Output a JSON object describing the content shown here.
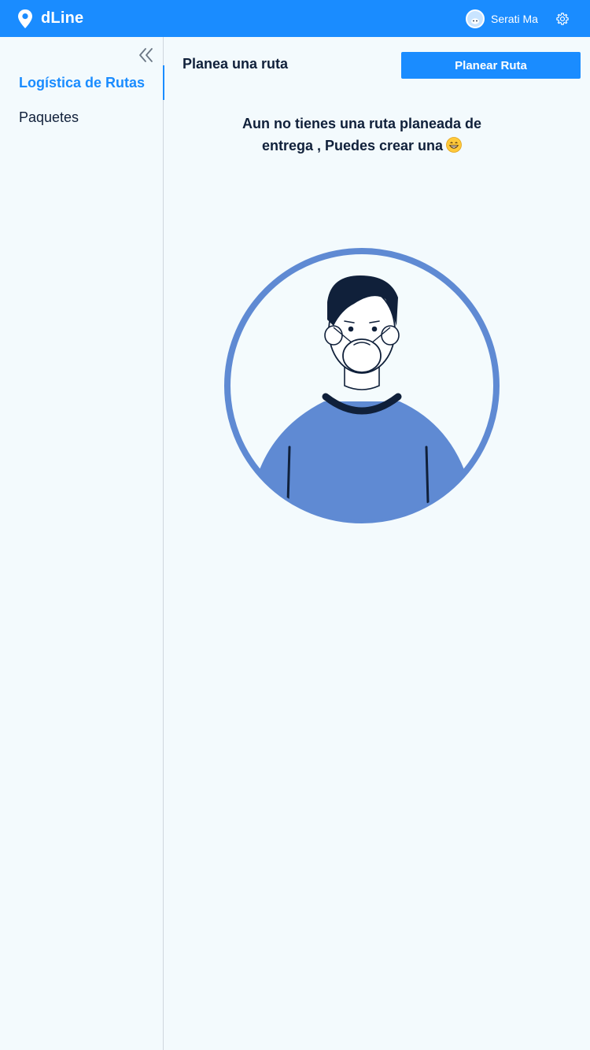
{
  "header": {
    "app_name": "dLine",
    "user_name": "Serati Ma",
    "brand_color": "#1a8cff",
    "icons": [
      "location-pin-icon",
      "avatar-icon",
      "gear-icon"
    ]
  },
  "sidebar": {
    "collapse_icon": "double-chevron-left-icon",
    "items": [
      {
        "label": "Logística de Rutas",
        "active": true
      },
      {
        "label": "Paquetes",
        "active": false
      }
    ]
  },
  "main": {
    "title": "Planea una ruta",
    "plan_button_label": "Planear Ruta",
    "empty_message_line1": "Aun no tienes una ruta planeada de",
    "empty_message_line2": "entrega , Puedes crear una",
    "emoji": "grinning-face-icon",
    "illustration": "masked-person-illustration"
  }
}
